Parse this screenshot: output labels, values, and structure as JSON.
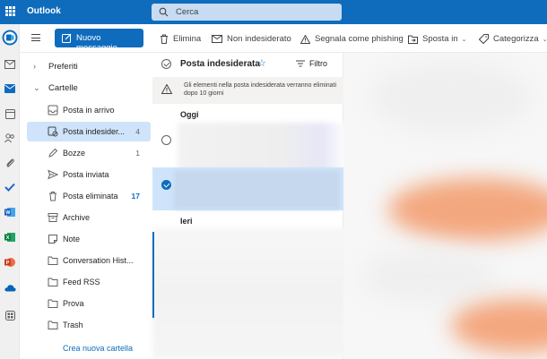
{
  "app": {
    "title": "Outlook"
  },
  "search": {
    "placeholder": "Cerca"
  },
  "toolbar": {
    "new_message": "Nuovo messaggio",
    "actions": [
      "Elimina",
      "Non indesiderato",
      "Segnala come phishing",
      "Sposta in",
      "Categorizza"
    ]
  },
  "folders": {
    "favorites": "Preferiti",
    "section": "Cartelle",
    "items": [
      {
        "label": "Posta in arrivo",
        "count": ""
      },
      {
        "label": "Posta indesider...",
        "count": "4"
      },
      {
        "label": "Bozze",
        "count": "1"
      },
      {
        "label": "Posta inviata",
        "count": ""
      },
      {
        "label": "Posta eliminata",
        "count": "17"
      },
      {
        "label": "Archive",
        "count": ""
      },
      {
        "label": "Note",
        "count": ""
      },
      {
        "label": "Conversation Hist...",
        "count": ""
      },
      {
        "label": "Feed RSS",
        "count": ""
      },
      {
        "label": "Prova",
        "count": ""
      },
      {
        "label": "Trash",
        "count": ""
      }
    ],
    "new_folder": "Crea nuova cartella"
  },
  "list": {
    "title": "Posta indesiderata",
    "filter": "Filtro",
    "notice": "Gli elementi nella posta indesiderata verranno eliminati dopo 10 giorni",
    "group_today": "Oggi",
    "group_yesterday": "Ieri"
  },
  "colors": {
    "accent": "#0f6cbd",
    "selected": "#cfe4fa"
  }
}
